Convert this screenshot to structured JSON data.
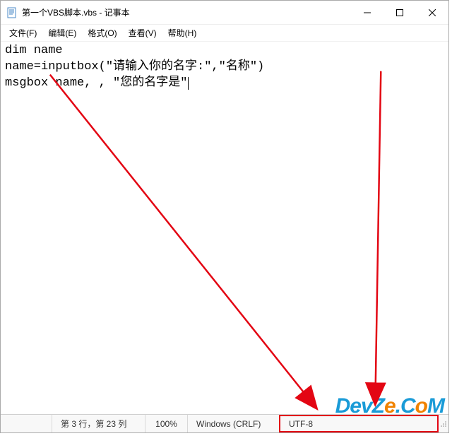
{
  "titlebar": {
    "title": "第一个VBS脚本.vbs - 记事本"
  },
  "menubar": {
    "file": "文件(F)",
    "edit": "编辑(E)",
    "format": "格式(O)",
    "view": "查看(V)",
    "help": "帮助(H)"
  },
  "editor": {
    "content": "dim name\nname=inputbox(\"请输入你的名字:\",\"名称\")\nmsgbox name, , \"您的名字是\""
  },
  "statusbar": {
    "position": "第 3 行，第 23 列",
    "zoom": "100%",
    "line_ending": "Windows (CRLF)",
    "encoding": "UTF-8"
  },
  "watermark": {
    "part1": "DevZ",
    "part2": "e",
    "part3": ".C",
    "part4": "o",
    "part5": "M"
  }
}
